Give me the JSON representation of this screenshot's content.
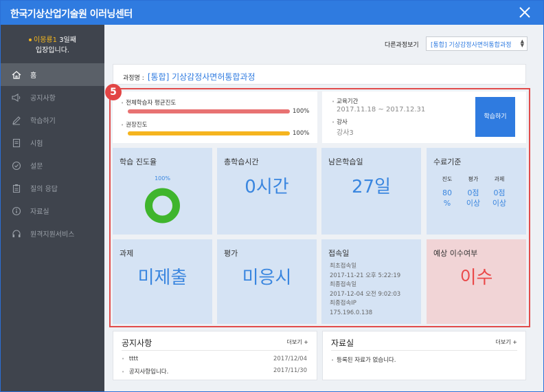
{
  "window": {
    "title": "한국기상산업기술원 이러닝센터"
  },
  "user": {
    "name": "이몽룡1",
    "day_text": "3일째",
    "line2": "입장입니다."
  },
  "menu": [
    {
      "label": "홈",
      "icon": "home-icon",
      "active": true
    },
    {
      "label": "공지사항",
      "icon": "megaphone-icon"
    },
    {
      "label": "학습하기",
      "icon": "pencil-icon"
    },
    {
      "label": "시험",
      "icon": "document-icon"
    },
    {
      "label": "설문",
      "icon": "check-circle-icon"
    },
    {
      "label": "질의 응답",
      "icon": "clipboard-icon"
    },
    {
      "label": "자료실",
      "icon": "info-icon"
    },
    {
      "label": "원격지원서비스",
      "icon": "headset-icon"
    }
  ],
  "course_select": {
    "label": "다른과정보기",
    "value": "[통합] 기상감정사면허통합과정"
  },
  "course": {
    "label": "과정명 :",
    "name": "[통합] 기상감정사면허통합과정"
  },
  "badge": "5",
  "progress": {
    "avg_label": "전체학습자 평균진도",
    "avg_value": 100,
    "avg_text": "100%",
    "rec_label": "권장진도",
    "rec_value": 100,
    "rec_text": "100%"
  },
  "info": {
    "period_label": "교육기간",
    "period_value": "2017.11.18 ~ 2017.12.31",
    "teacher_label": "강사",
    "teacher_value": "강사3",
    "study_button": "학습하기"
  },
  "tiles": {
    "progress_rate": {
      "title": "학습 진도율",
      "value": 100,
      "text": "100%"
    },
    "total_time": {
      "title": "총학습시간",
      "value": "0시간"
    },
    "remaining": {
      "title": "남은학습일",
      "value": "27일"
    },
    "criteria": {
      "title": "수료기준",
      "h1": "진도",
      "h2": "평가",
      "h3": "과제",
      "v1a": "80",
      "v1b": "%",
      "v2a": "0점",
      "v2b": "이상",
      "v3a": "0점",
      "v3b": "이상"
    },
    "assignment": {
      "title": "과제",
      "value": "미제출"
    },
    "evaluation": {
      "title": "평가",
      "value": "미응시"
    },
    "access": {
      "title": "접속일",
      "first_label": "최초접속일",
      "first_value": "2017-11-21 오후 5:22:19",
      "last_label": "최종접속일",
      "last_value": "2017-12-04 오전 9:02:03",
      "ip_label": "최종접속IP",
      "ip_value": "175.196.0.138"
    },
    "completion": {
      "title": "예상 이수여부",
      "value": "이수"
    }
  },
  "notice": {
    "title": "공지사항",
    "more": "더보기 +",
    "items": [
      {
        "text": "tttt",
        "date": "2017/12/04"
      },
      {
        "text": "공지사항입니다.",
        "date": "2017/11/30"
      }
    ]
  },
  "library": {
    "title": "자료실",
    "more": "더보기 +",
    "empty": "등록된 자료가 없습니다."
  },
  "colors": {
    "brand": "#2f7be0",
    "sidebar": "#3f444d",
    "tile": "#d5e3f4",
    "tile_red": "#f1d4d6",
    "bar_red": "#e87272",
    "bar_yellow": "#f5b41e",
    "donut": "#3fb52d",
    "highlight": "#e14b4b"
  }
}
